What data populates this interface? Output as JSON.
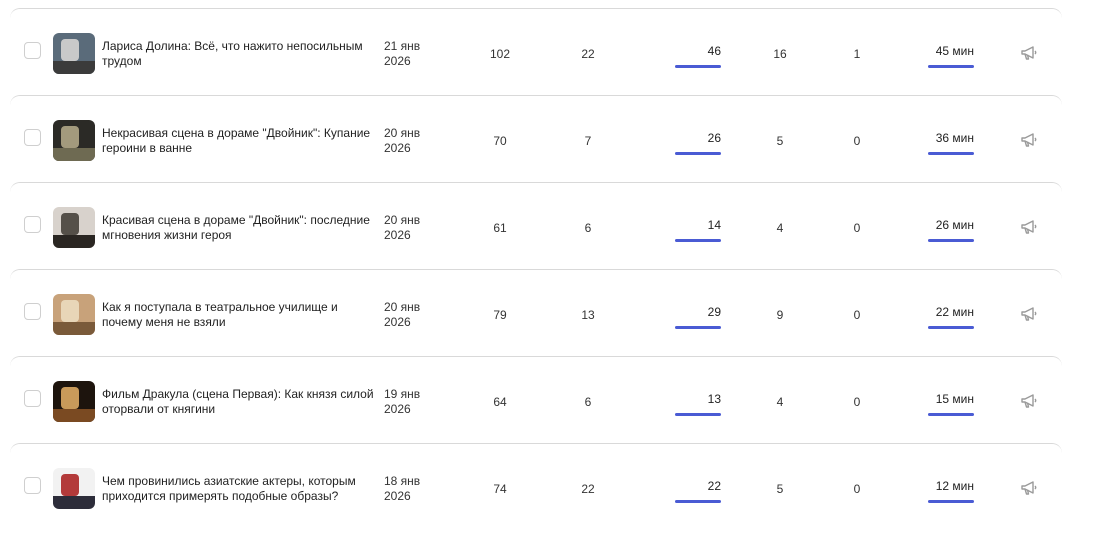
{
  "rows": [
    {
      "title": "Лариса Долина: Всё, что нажито непосильным трудом",
      "date_line1": "21 янв",
      "date_line2": "2026",
      "views": "102",
      "comments": "22",
      "reads": "46",
      "likes": "16",
      "shares": "1",
      "time": "45 мин",
      "thumb_colors": [
        "#5a6b7a",
        "#c9c9c9",
        "#3b3b3b"
      ]
    },
    {
      "title": "Некрасивая сцена в дораме \"Двойник\": Купание героини в ванне",
      "date_line1": "20 янв",
      "date_line2": "2026",
      "views": "70",
      "comments": "7",
      "reads": "26",
      "likes": "5",
      "shares": "0",
      "time": "36 мин",
      "thumb_colors": [
        "#2b2a26",
        "#a39a7d",
        "#6e6a52"
      ]
    },
    {
      "title": "Красивая сцена в дораме \"Двойник\": последние мгновения жизни героя",
      "date_line1": "20 янв",
      "date_line2": "2026",
      "views": "61",
      "comments": "6",
      "reads": "14",
      "likes": "4",
      "shares": "0",
      "time": "26 мин",
      "thumb_colors": [
        "#d8d2cc",
        "#555049",
        "#2a2622"
      ]
    },
    {
      "title": "Как я поступала в театральное училище и почему меня не взяли",
      "date_line1": "20 янв",
      "date_line2": "2026",
      "views": "79",
      "comments": "13",
      "reads": "29",
      "likes": "9",
      "shares": "0",
      "time": "22 мин",
      "thumb_colors": [
        "#c8a27a",
        "#e8d6b8",
        "#7a5a3a"
      ]
    },
    {
      "title": "Фильм Дракула (сцена Первая): Как князя силой оторвали от княгини",
      "date_line1": "19 янв",
      "date_line2": "2026",
      "views": "64",
      "comments": "6",
      "reads": "13",
      "likes": "4",
      "shares": "0",
      "time": "15 мин",
      "thumb_colors": [
        "#1d140d",
        "#c99a5a",
        "#7a4a22"
      ]
    },
    {
      "title": "Чем провинились азиатские актеры, которым приходится примерять подобные образы?",
      "date_line1": "18 янв",
      "date_line2": "2026",
      "views": "74",
      "comments": "22",
      "reads": "22",
      "likes": "5",
      "shares": "0",
      "time": "12 мин",
      "thumb_colors": [
        "#f2f2f2",
        "#b33a3a",
        "#2d2d3a"
      ]
    }
  ],
  "colors": {
    "accent_bar": "#4a5bd4",
    "divider": "#d9d9d9"
  },
  "icons": {
    "promote": "megaphone-icon"
  }
}
